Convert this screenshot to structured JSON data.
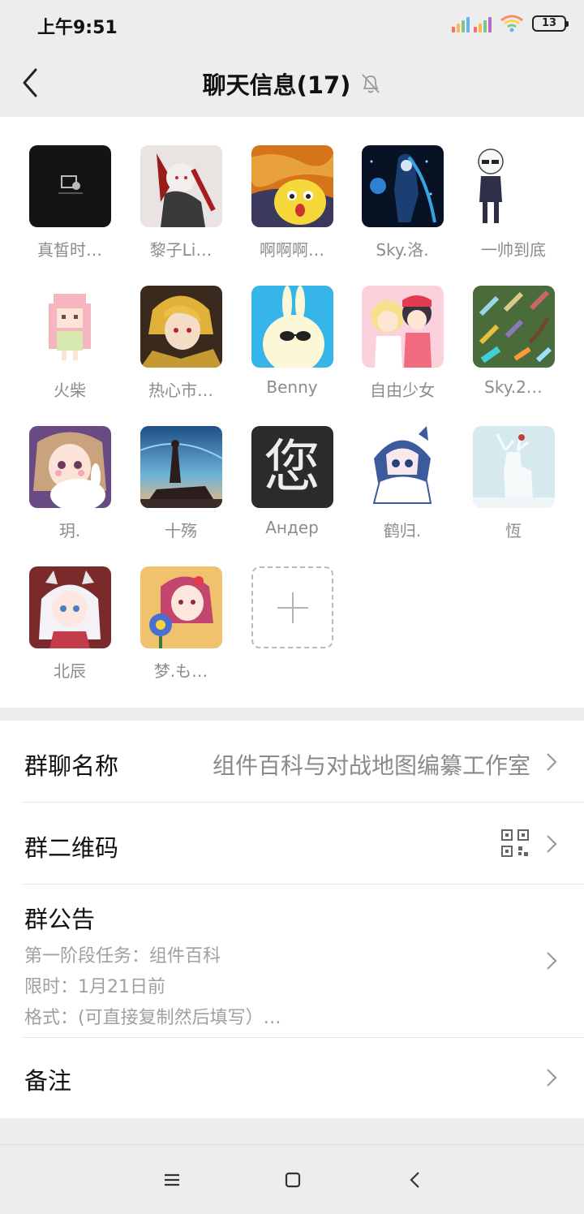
{
  "status_bar": {
    "time": "上午9:51",
    "battery": "13"
  },
  "header": {
    "title": "聊天信息(17)"
  },
  "members": [
    {
      "name": "真皙时…",
      "icon": "dark-image-avatar"
    },
    {
      "name": "黎子Li…",
      "icon": "anime-wolf-avatar"
    },
    {
      "name": "啊啊啊…",
      "icon": "scream-cat-avatar"
    },
    {
      "name": "Sky.洛.",
      "icon": "blue-anime-avatar"
    },
    {
      "name": "一帅到底",
      "icon": "chibi-sunglasses-avatar"
    },
    {
      "name": "火柴",
      "icon": "pixel-girl-avatar"
    },
    {
      "name": "热心市…",
      "icon": "anime-gold-hair-avatar"
    },
    {
      "name": "Benny",
      "icon": "bunny-sunglasses-avatar"
    },
    {
      "name": "自由少女",
      "icon": "two-girls-avatar"
    },
    {
      "name": "Sky.2…",
      "icon": "pixel-swords-avatar"
    },
    {
      "name": "玥.",
      "icon": "girl-with-bunny-avatar"
    },
    {
      "name": "十殇",
      "icon": "night-sky-avatar"
    },
    {
      "name": "Андер",
      "icon": "calligraphy-avatar"
    },
    {
      "name": "鹤归.",
      "icon": "shark-hood-girl-avatar"
    },
    {
      "name": "恆",
      "icon": "white-deer-avatar"
    },
    {
      "name": "北辰",
      "icon": "dragon-maid-avatar"
    },
    {
      "name": "梦.も…",
      "icon": "pink-hair-flower-avatar"
    }
  ],
  "avatar_calligraphy_char": "您",
  "settings": {
    "group_name_label": "群聊名称",
    "group_name_value": "组件百科与对战地图编纂工作室",
    "qr_label": "群二维码",
    "notice_label": "群公告",
    "notice_lines": [
      "第一阶段任务：组件百科",
      "限时：1月21日前",
      "格式：(可直接复制然后填写）…"
    ],
    "remark_label": "备注"
  },
  "colors": {
    "background": "#ededed",
    "card": "#ffffff",
    "secondary_text": "#8c8c8c"
  }
}
